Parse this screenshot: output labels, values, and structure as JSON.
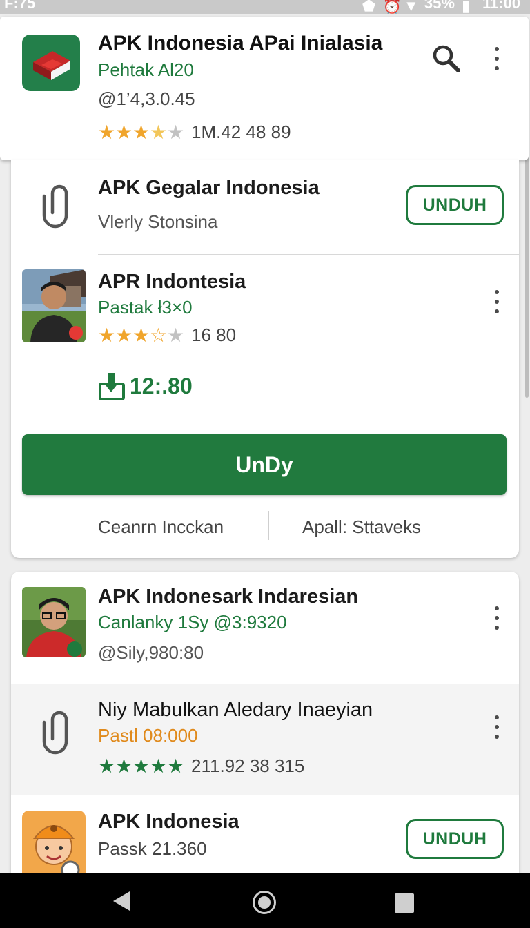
{
  "status_bar": {
    "time": "F:75",
    "battery": "35%",
    "clock": "11:00"
  },
  "header": {
    "title": "APK Indonesia APai Inialasia",
    "subtitle": "Pehtak Al20",
    "version": "@1’4,3.0.45",
    "rating_stars": 3.5,
    "meta": "1M.42 48   89"
  },
  "featured": {
    "item1": {
      "title": "APK Gegalar Indonesia",
      "subtitle": "Vlerly Stonsina",
      "button": "UNDUH"
    },
    "item2": {
      "title": "APR Indontesia",
      "subtitle": "Pastak ł3×0",
      "rating_stars": 2.5,
      "meta": "16  80",
      "size": "12:.80"
    },
    "download_button": "UnDy",
    "footer_left": "Ceanrn Incckan",
    "footer_right": "Apall: Sttaveks"
  },
  "list": {
    "item1": {
      "title": "APK Indonesark Indaresian",
      "subtitle": "Canlanky 1Sy  @3:9320",
      "meta": "@Sily,980:80"
    },
    "item2": {
      "title": "Niy Mabulkan Aledary Inaeyian",
      "subtitle": "Pastl 08:000",
      "rating_stars": 5,
      "meta": "211.92 38  315"
    },
    "item3": {
      "title": "APK Indonesia",
      "subtitle": "Passk 21.360",
      "button": "UNDUH"
    }
  },
  "colors": {
    "accent": "#217a3e",
    "star": "#f0a52c",
    "orange": "#e08a1c"
  }
}
